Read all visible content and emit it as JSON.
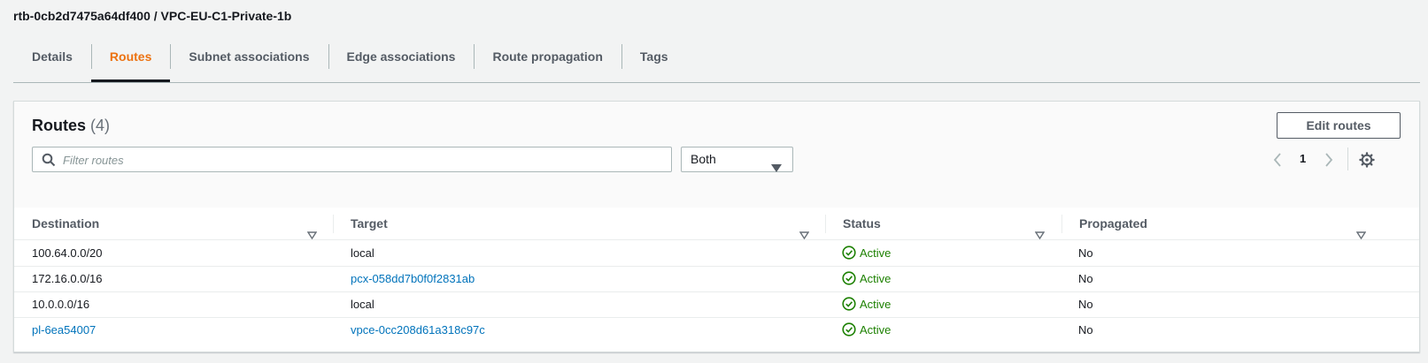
{
  "page": {
    "title": "rtb-0cb2d7475a64df400 / VPC-EU-C1-Private-1b"
  },
  "tabs": [
    {
      "label": "Details",
      "active": false
    },
    {
      "label": "Routes",
      "active": true
    },
    {
      "label": "Subnet associations",
      "active": false
    },
    {
      "label": "Edge associations",
      "active": false
    },
    {
      "label": "Route propagation",
      "active": false
    },
    {
      "label": "Tags",
      "active": false
    }
  ],
  "routes_panel": {
    "title": "Routes",
    "count": "(4)",
    "edit_button": "Edit routes",
    "filter_placeholder": "Filter routes",
    "filter_value": "",
    "select_value": "Both",
    "page_number": "1"
  },
  "table": {
    "columns": [
      "Destination",
      "Target",
      "Status",
      "Propagated"
    ],
    "rows": [
      {
        "destination": "100.64.0.0/20",
        "target": "local",
        "status": "Active",
        "propagated": "No",
        "destination_link": false,
        "target_link": false
      },
      {
        "destination": "172.16.0.0/16",
        "target": "pcx-058dd7b0f0f2831ab",
        "status": "Active",
        "propagated": "No",
        "destination_link": false,
        "target_link": true
      },
      {
        "destination": "10.0.0.0/16",
        "target": "local",
        "status": "Active",
        "propagated": "No",
        "destination_link": false,
        "target_link": false
      },
      {
        "destination": "pl-6ea54007",
        "target": "vpce-0cc208d61a318c97c",
        "status": "Active",
        "propagated": "No",
        "destination_link": true,
        "target_link": true
      }
    ]
  },
  "colors": {
    "accent_active_tab": "#ec7211",
    "link": "#0073bb",
    "status_success": "#1d8102"
  },
  "icons": {
    "search": "search-icon",
    "caret": "caret-down-icon",
    "prev": "chevron-left-icon",
    "next": "chevron-right-icon",
    "settings": "gear-icon",
    "sort": "sort-icon",
    "status": "check-circle-icon"
  }
}
